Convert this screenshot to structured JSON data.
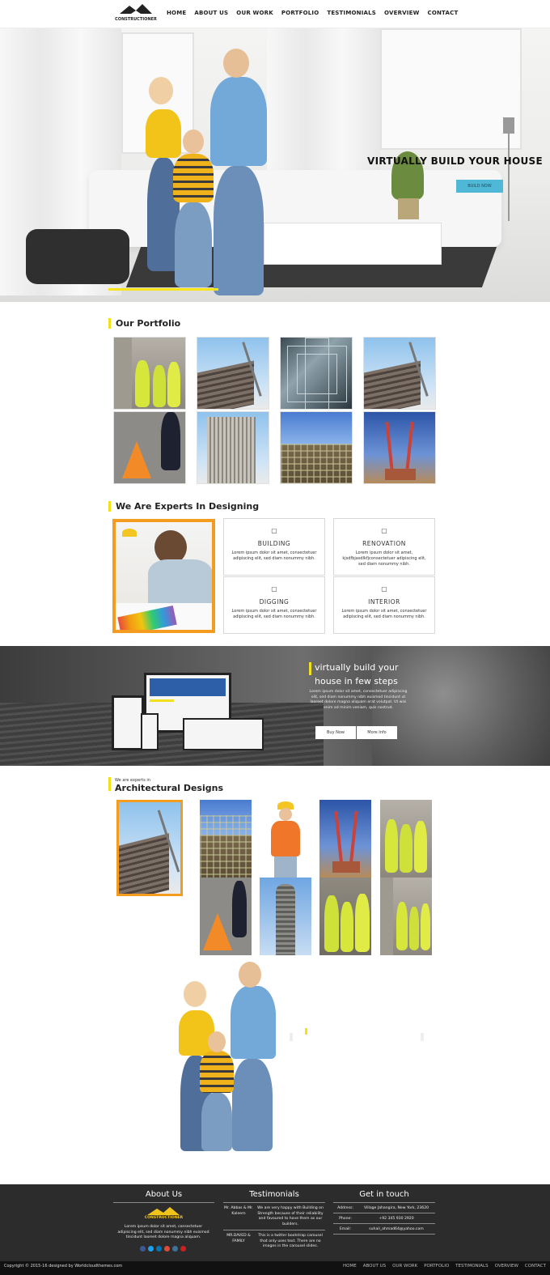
{
  "brand": {
    "logo_text": "CONSTRUCTIONER"
  },
  "nav": {
    "items": [
      "HOME",
      "ABOUT US",
      "OUR WORK",
      "PORTFOLIO",
      "TESTIMONIALS",
      "OVERVIEW",
      "CONTACT"
    ]
  },
  "hero": {
    "title": "VIRTUALLY BUILD YOUR HOUSE",
    "button": "BUILD NOW",
    "progress": 0.5
  },
  "portfolio": {
    "heading": "Our Portfolio"
  },
  "experts": {
    "heading": "We Are Experts In Designing",
    "features": [
      {
        "icon": "building-icon",
        "title": "BUILDING",
        "text": "Lorem ipsum dolor sit amet, consectetuer adipiscing elit, sed diam nonummy nibh."
      },
      {
        "icon": "renovation-icon",
        "title": "RENOVATION",
        "text": "Lorem ipsum dolor sit amet, kjsdfbjasdlkfjconsectetuer adipiscing elit, sed diam nonummy nibh."
      },
      {
        "icon": "digging-icon",
        "title": "DIGGING",
        "text": "Lorem ipsum dolor sit amet, consectetuer adipiscing elit, sed diam nonummy nibh."
      },
      {
        "icon": "interior-icon",
        "title": "INTERIOR",
        "text": "Lorem ipsum dolor sit amet, consectetuer adipiscing elit, sed diam nonummy nibh."
      }
    ]
  },
  "band": {
    "title_line1": "virtually build your",
    "title_line2": "house in few steps",
    "text": "Lorem ipsum dolor sit amet, consectetuer adipiscing elit, sed diam nonummy nibh euismod tincidunt ut laoreet dolore magna aliquam erat volutpat. Ut wisi enim ad minim veniam, quis nostrud.",
    "buy_now": "Buy Now",
    "more_info": "More Info"
  },
  "architectural": {
    "kicker": "We are experts in",
    "heading": "Architectural Designs"
  },
  "footer": {
    "about": {
      "title": "About Us",
      "logo_text": "CONSTRUCTIONER",
      "text": "Lorem ipsum dolor sit amet, consectetuer adipiscing elit, sed diam nonummy nibh euismod tincidunt laoreet dolore magna aliquam."
    },
    "testimonials": {
      "title": "Testimonials",
      "items": [
        {
          "name": "Mr. Abbas & Mr. Kaleem",
          "quote": "We are very happy with Building on Strength because of their reliability and favoured to have them as our builders."
        },
        {
          "name": "MR.DAVED & FAMILY",
          "quote": "This is a twitter bootstrap carousel that only uses text. There are no images in the carousel slides."
        }
      ]
    },
    "contact": {
      "title": "Get in touch",
      "rows": [
        {
          "label": "Address:",
          "value": "Village Jahangira, New York, 23620"
        },
        {
          "label": "Phone:",
          "value": "+92 345 930 2920"
        },
        {
          "label": "Email:",
          "value": "suhail_ahmad64@yahoo.com"
        }
      ]
    },
    "social": [
      {
        "icon": "facebook-icon",
        "color": "#3b5998"
      },
      {
        "icon": "twitter-icon",
        "color": "#1da1f2"
      },
      {
        "icon": "linkedin-icon",
        "color": "#0077b5"
      },
      {
        "icon": "google-plus-icon",
        "color": "#dd4b39"
      },
      {
        "icon": "instagram-icon",
        "color": "#3f729b"
      },
      {
        "icon": "youtube-icon",
        "color": "#cd201f"
      }
    ],
    "copyright": "Copyright © 2015-16 designed by Worldcloudthemes.com",
    "nav": [
      "HOME",
      "ABOUT US",
      "OUR WORK",
      "PORTFOLIO",
      "TESTIMONIALS",
      "OVERVIEW",
      "CONTACT"
    ]
  },
  "colors": {
    "accent_yellow": "#f2e01b",
    "accent_orange": "#f39c1f",
    "hero_button": "#4fb8d6",
    "footer_bg": "#2c2c2c"
  }
}
